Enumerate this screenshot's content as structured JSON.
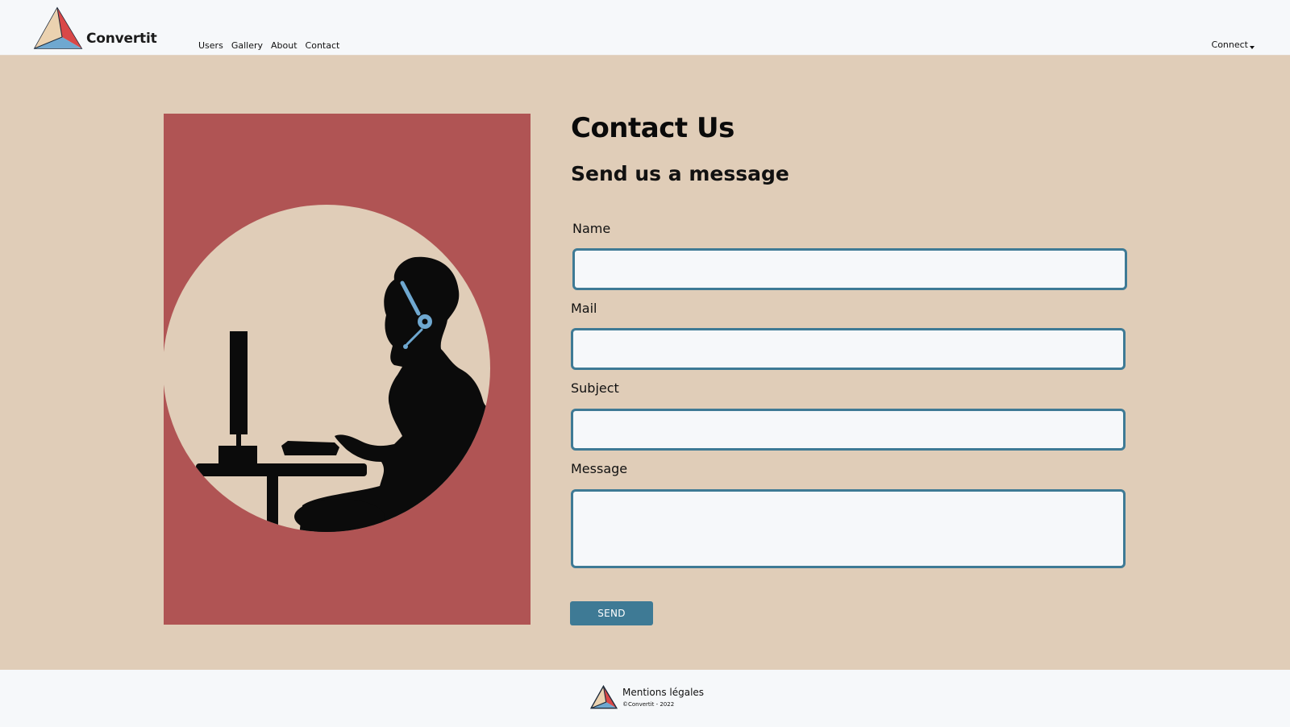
{
  "header": {
    "brand_name": "Convertit",
    "nav": [
      "Users",
      "Gallery",
      "About",
      "Contact"
    ],
    "connect_label": "Connect"
  },
  "main": {
    "title": "Contact Us",
    "subtitle": "Send us a message",
    "form": {
      "name_label": "Name",
      "name_value": "",
      "mail_label": "Mail",
      "mail_value": "",
      "subject_label": "Subject",
      "subject_value": "",
      "message_label": "Message",
      "message_value": "",
      "send_label": "SEND"
    }
  },
  "footer": {
    "legal_label": "Mentions légales",
    "copyright": "©Convertit - 2022"
  },
  "colors": {
    "page_background": "#e0cdb8",
    "header_background": "#f6f8fa",
    "illustration_background": "#b05454",
    "accent": "#3e7a95",
    "headset": "#6fa8d0"
  },
  "icons": {
    "logo": "triangle-logo-icon",
    "connect_caret": "caret-down-icon",
    "illustration": "support-agent-silhouette"
  }
}
